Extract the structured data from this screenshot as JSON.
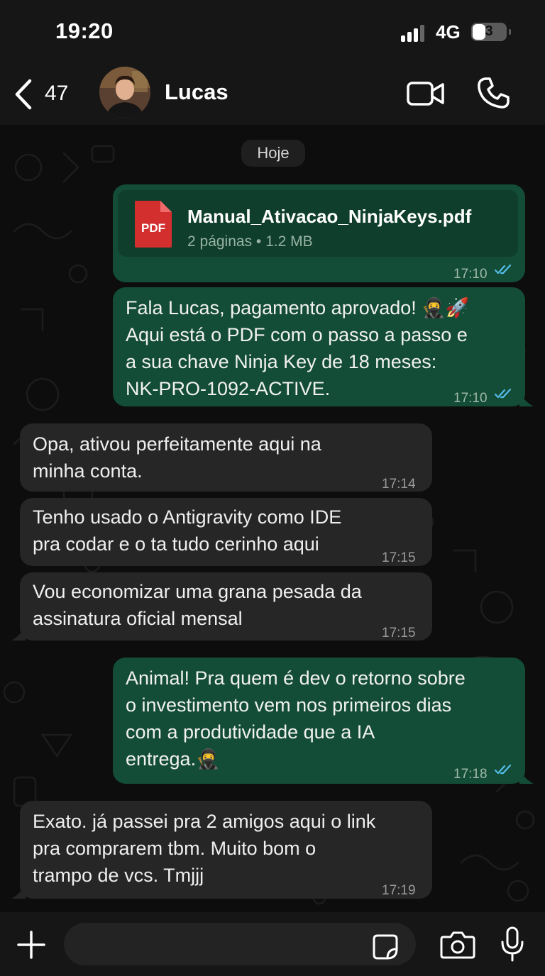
{
  "status_bar": {
    "time": "19:20",
    "network": "4G",
    "battery": "3",
    "signal_bars_filled": 3
  },
  "header": {
    "back_count": "47",
    "contact_name": "Lucas",
    "icons": [
      "back-chevron-icon",
      "video-call-icon",
      "phone-icon"
    ]
  },
  "chat": {
    "date_chip": "Hoje",
    "document": {
      "file_name": "Manual_Ativacao_NinjaKeys.pdf",
      "file_info": "2 páginas • 1.2 MB",
      "icon_label": "PDF",
      "time": "17:10"
    },
    "messages": [
      {
        "direction": "out",
        "text": "Fala Lucas, pagamento aprovado! 🥷🚀\nAqui está o PDF com o passo a passo e\na sua chave Ninja Key de 18 meses:\nNK-PRO-1092-ACTIVE.",
        "time": "17:10",
        "read": true
      },
      {
        "direction": "in",
        "text": "Opa, ativou perfeitamente aqui na\nminha conta.",
        "time": "17:14"
      },
      {
        "direction": "in",
        "text": "Tenho usado o Antigravity como IDE\npra codar e o ta tudo cerinho aqui",
        "time": "17:15"
      },
      {
        "direction": "in",
        "text": "Vou economizar uma grana pesada da\nassinatura oficial mensal",
        "time": "17:15"
      },
      {
        "direction": "out",
        "text": "Animal! Pra quem é dev o retorno sobre\no investimento vem nos primeiros dias\ncom a produtividade que a IA\nentrega.🥷",
        "time": "17:18",
        "read": true
      },
      {
        "direction": "in",
        "text": "Exato. já passei pra 2 amigos aqui o link\npra comprarem tbm. Muito bom o\ntrampo de vcs. Tmjjj",
        "time": "17:19"
      }
    ]
  },
  "input_bar": {
    "placeholder": "",
    "icons": [
      "plus-icon",
      "sticker-icon",
      "camera-icon",
      "microphone-icon"
    ]
  },
  "colors": {
    "outgoing_bubble": "#144d37",
    "incoming_bubble": "#262626",
    "read_ticks": "#53bdeb",
    "background": "#0d0d0d"
  }
}
